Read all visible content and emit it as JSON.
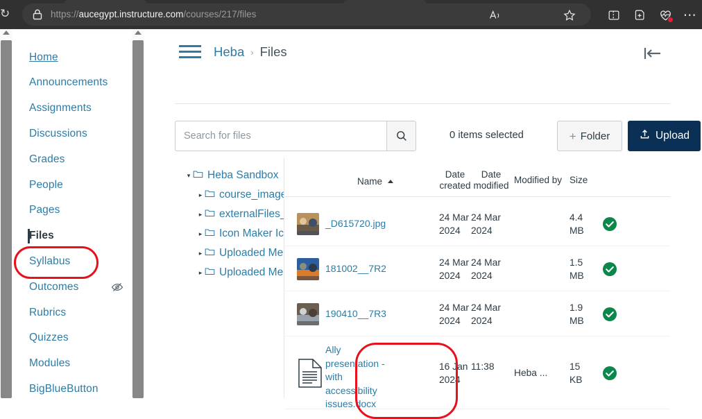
{
  "browser": {
    "url_prefix": "https://",
    "url_host": "aucegypt.instructure.com",
    "url_path": "/courses/217/files",
    "lock_icon": "lock-icon",
    "read_aloud_icon": "read-aloud-icon",
    "favorite_icon": "star-icon",
    "split_screen_icon": "split-screen-icon",
    "collections_icon": "add-to-collections-icon",
    "browser_essentials_icon": "browser-essentials-icon",
    "settings_icon": "more-options-icon"
  },
  "course_nav": {
    "items": [
      {
        "label": "Home",
        "active": false,
        "hidden_icon": false
      },
      {
        "label": "Announcements",
        "active": false,
        "hidden_icon": false
      },
      {
        "label": "Assignments",
        "active": false,
        "hidden_icon": false
      },
      {
        "label": "Discussions",
        "active": false,
        "hidden_icon": false
      },
      {
        "label": "Grades",
        "active": false,
        "hidden_icon": false
      },
      {
        "label": "People",
        "active": false,
        "hidden_icon": false
      },
      {
        "label": "Pages",
        "active": false,
        "hidden_icon": false
      },
      {
        "label": "Files",
        "active": true,
        "hidden_icon": false
      },
      {
        "label": "Syllabus",
        "active": false,
        "hidden_icon": false
      },
      {
        "label": "Outcomes",
        "active": false,
        "hidden_icon": true
      },
      {
        "label": "Rubrics",
        "active": false,
        "hidden_icon": false
      },
      {
        "label": "Quizzes",
        "active": false,
        "hidden_icon": false
      },
      {
        "label": "Modules",
        "active": false,
        "hidden_icon": false
      },
      {
        "label": "BigBlueButton",
        "active": false,
        "hidden_icon": false
      }
    ]
  },
  "header": {
    "menu_icon": "hamburger-menu-icon",
    "breadcrumb_root": "Heba",
    "breadcrumb_separator": "›",
    "breadcrumb_current": "Files",
    "collapse_icon": "collapse-panel-icon"
  },
  "toolbar": {
    "search_placeholder": "Search for files",
    "search_value": "",
    "search_icon": "search-icon",
    "items_selected": "0 items selected",
    "folder_label": "Folder",
    "folder_plus": "+",
    "upload_label": "Upload",
    "upload_icon": "upload-arrow-icon"
  },
  "tree": {
    "items": [
      {
        "label": "Heba Sandbox",
        "indent": 0,
        "caret": "▾"
      },
      {
        "label": "course_image",
        "indent": 1,
        "caret": "▸"
      },
      {
        "label": "externalFiles_",
        "indent": 1,
        "caret": "▸"
      },
      {
        "label": "Icon Maker Ic",
        "indent": 1,
        "caret": "▸"
      },
      {
        "label": "Uploaded Me",
        "indent": 1,
        "caret": "▸"
      },
      {
        "label": "Uploaded Me",
        "indent": 1,
        "caret": "▸"
      }
    ]
  },
  "table": {
    "headers": {
      "name": "Name",
      "date_created": "Date created",
      "date_modified": "Date modified",
      "modified_by": "Modified by",
      "size": "Size"
    },
    "sort_indicator": "▲",
    "rows": [
      {
        "name": "_D615720.jpg",
        "date_created": "24 Mar 2024",
        "date_modified": "24 Mar 2024",
        "modified_by": "",
        "size": "4.4 MB",
        "icon": "image-thumbnail",
        "published": true,
        "published_icon": "published-check-icon"
      },
      {
        "name": "181002__7R2",
        "date_created": "24 Mar 2024",
        "date_modified": "24 Mar 2024",
        "modified_by": "",
        "size": "1.5 MB",
        "icon": "image-thumbnail",
        "published": true,
        "published_icon": "published-check-icon"
      },
      {
        "name": "190410__7R3",
        "date_created": "24 Mar 2024",
        "date_modified": "24 Mar 2024",
        "modified_by": "",
        "size": "1.9 MB",
        "icon": "image-thumbnail",
        "published": true,
        "published_icon": "published-check-icon"
      },
      {
        "name": "Ally presentation - with accessibility issues.docx",
        "date_created": "16 Jan 2024",
        "date_modified": "11:38",
        "modified_by": "Heba ...",
        "size": "15 KB",
        "icon": "document-icon",
        "published": true,
        "published_icon": "published-check-icon"
      }
    ]
  },
  "annotations": {
    "files_highlight": "red-oval-around-files-nav",
    "doc_highlight": "red-oval-around-docx-file"
  },
  "colors": {
    "link": "#2c7ca6",
    "text": "#2d3b45",
    "upload_button": "#0a3055",
    "published_green": "#0b874b",
    "annotation_red": "#e8101a",
    "chrome_bg": "#313131"
  }
}
